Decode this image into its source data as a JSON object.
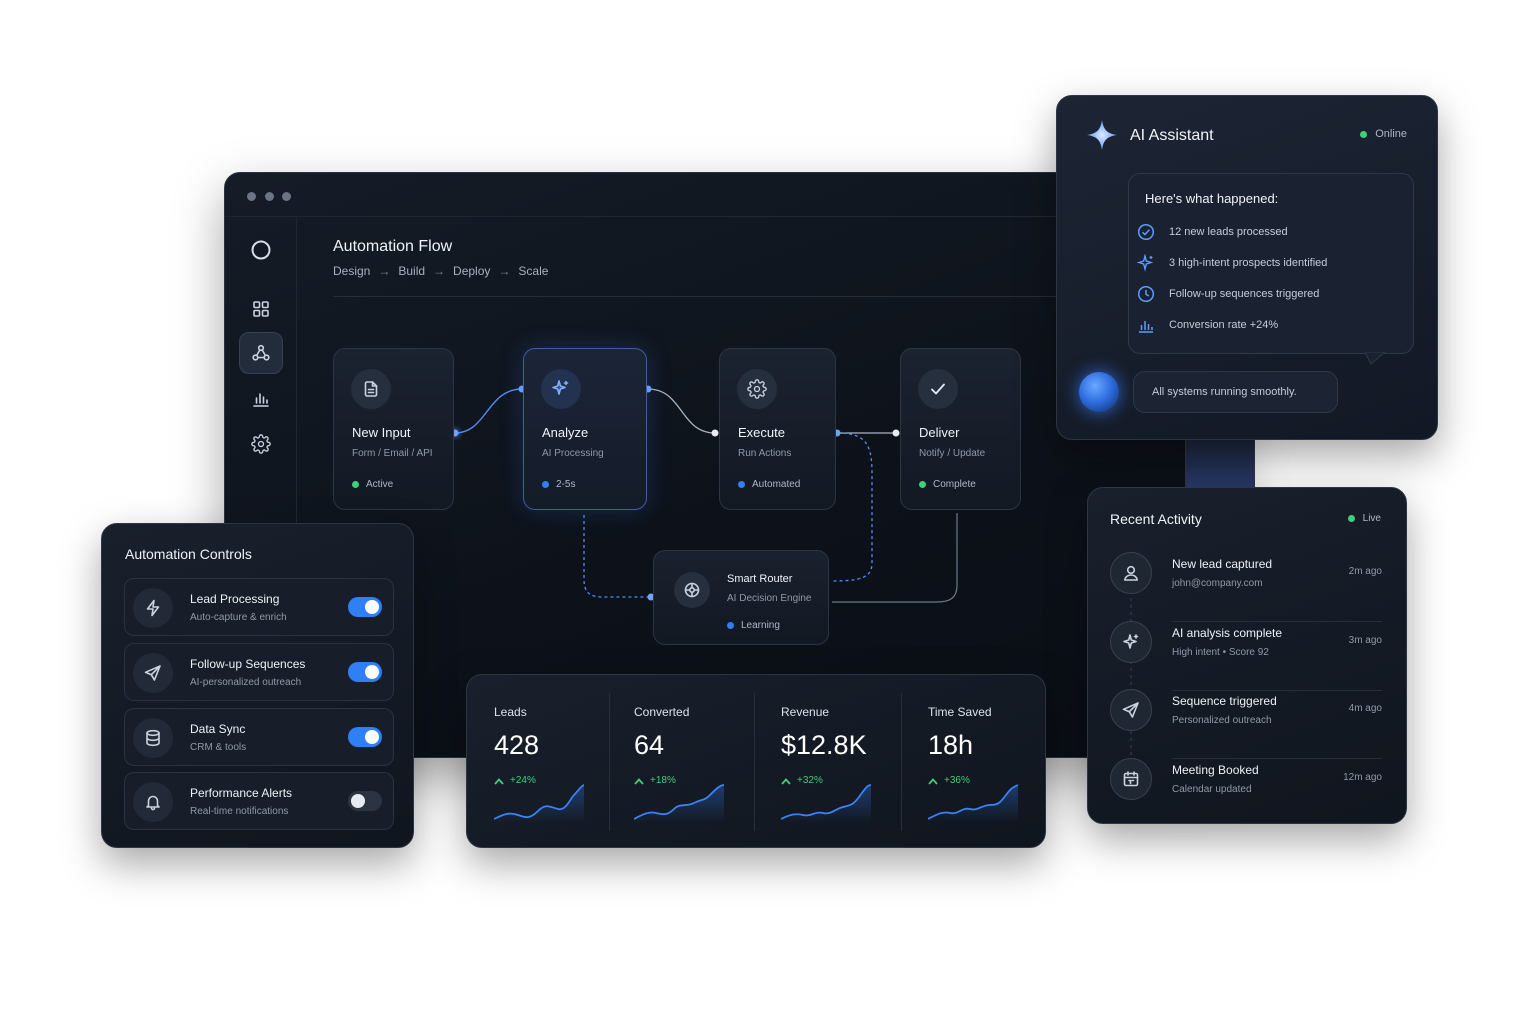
{
  "flow": {
    "title": "Automation Flow",
    "breadcrumb": [
      "Design",
      "Build",
      "Deploy",
      "Scale"
    ],
    "arrow": "→",
    "nodes": [
      {
        "title": "New Input",
        "subtitle": "Form / Email / API",
        "status": "Active",
        "status_color": "#3fce7a",
        "icon": "document-icon"
      },
      {
        "title": "Analyze",
        "subtitle": "AI Processing",
        "status": "2-5s",
        "status_color": "#2f7ff7",
        "icon": "sparkle-icon"
      },
      {
        "title": "Execute",
        "subtitle": "Run Actions",
        "status": "Automated",
        "status_color": "#2f7ff7",
        "icon": "gear-icon"
      },
      {
        "title": "Deliver",
        "subtitle": "Notify / Update",
        "status": "Complete",
        "status_color": "#3fce7a",
        "icon": "check-icon"
      }
    ],
    "router": {
      "title": "Smart Router",
      "subtitle": "AI Decision Engine",
      "status": "Learning",
      "status_color": "#2f7ff7",
      "icon": "chip-icon"
    }
  },
  "sidebar": {
    "items": [
      {
        "name": "logo",
        "icon": "circle-logo-icon"
      },
      {
        "name": "dashboard",
        "icon": "grid-icon"
      },
      {
        "name": "workflow",
        "icon": "nodes-icon",
        "active": true
      },
      {
        "name": "analytics",
        "icon": "bar-chart-icon"
      },
      {
        "name": "settings",
        "icon": "gear-icon"
      }
    ]
  },
  "controls": {
    "title": "Automation Controls",
    "items": [
      {
        "label": "Lead Processing",
        "sub": "Auto-capture & enrich",
        "on": true,
        "icon": "lightning-icon"
      },
      {
        "label": "Follow-up Sequences",
        "sub": "AI-personalized outreach",
        "on": true,
        "icon": "send-icon"
      },
      {
        "label": "Data Sync",
        "sub": "CRM & tools",
        "on": true,
        "icon": "database-icon"
      },
      {
        "label": "Performance Alerts",
        "sub": "Real-time notifications",
        "on": false,
        "icon": "bell-icon"
      }
    ]
  },
  "metrics": [
    {
      "label": "Leads",
      "value": "428",
      "change": "+24%"
    },
    {
      "label": "Converted",
      "value": "64",
      "change": "+18%"
    },
    {
      "label": "Revenue",
      "value": "$12.8K",
      "change": "+32%"
    },
    {
      "label": "Time Saved",
      "value": "18h",
      "change": "+36%"
    }
  ],
  "assistant": {
    "title": "AI Assistant",
    "status": "Online",
    "status_color": "#3fce7a",
    "heading": "Here's what happened:",
    "items": [
      {
        "text": "12 new leads processed",
        "icon": "check-circle-icon"
      },
      {
        "text": "3 high-intent prospects identified",
        "icon": "sparkle-icon"
      },
      {
        "text": "Follow-up sequences triggered",
        "icon": "clock-icon"
      },
      {
        "text": "Conversion rate +24%",
        "icon": "bar-chart-icon"
      }
    ],
    "message": "All systems running smoothly."
  },
  "activity": {
    "title": "Recent Activity",
    "status": "Live",
    "status_color": "#3fce7a",
    "items": [
      {
        "title": "New lead captured",
        "sub": "john@company.com",
        "time": "2m ago",
        "icon": "user-icon"
      },
      {
        "title": "AI analysis complete",
        "sub": "High intent • Score 92",
        "time": "3m ago",
        "icon": "sparkle-icon"
      },
      {
        "title": "Sequence triggered",
        "sub": "Personalized outreach",
        "time": "4m ago",
        "icon": "send-icon"
      },
      {
        "title": "Meeting Booked",
        "sub": "Calendar updated",
        "time": "12m ago",
        "icon": "calendar-icon"
      }
    ]
  }
}
